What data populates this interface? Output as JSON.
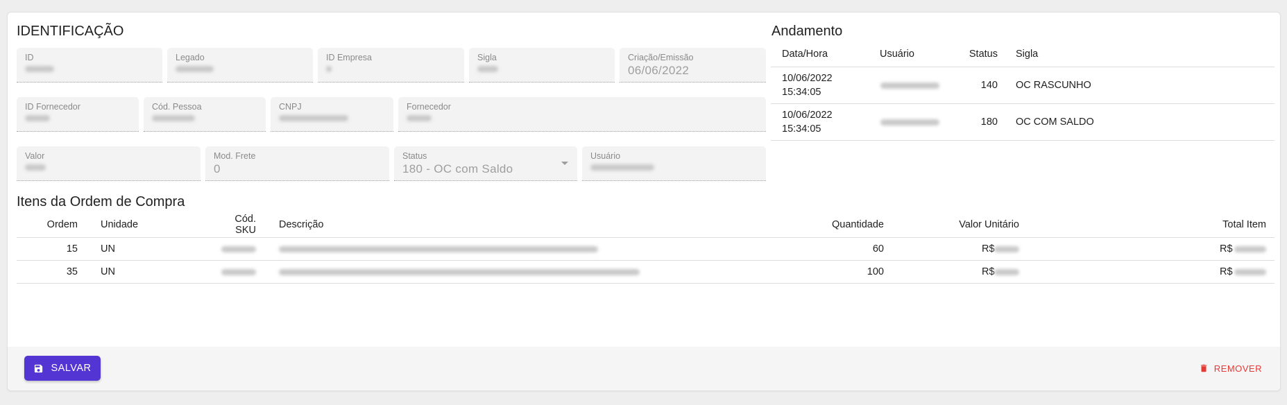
{
  "identificacao": {
    "title": "IDENTIFICAÇÃO",
    "fields": {
      "id": {
        "label": "ID",
        "value": ""
      },
      "legado": {
        "label": "Legado",
        "value": ""
      },
      "id_empresa": {
        "label": "ID Empresa",
        "value": ""
      },
      "sigla": {
        "label": "Sigla",
        "value": ""
      },
      "criacao": {
        "label": "Criação/Emissão",
        "value": "06/06/2022"
      },
      "id_fornecedor": {
        "label": "ID Fornecedor",
        "value": ""
      },
      "cod_pessoa": {
        "label": "Cód. Pessoa",
        "value": ""
      },
      "cnpj": {
        "label": "CNPJ",
        "value": ""
      },
      "fornecedor": {
        "label": "Fornecedor",
        "value": ""
      },
      "valor": {
        "label": "Valor",
        "value": ""
      },
      "mod_frete": {
        "label": "Mod. Frete",
        "value": "0"
      },
      "status": {
        "label": "Status",
        "value": "180 - OC com Saldo"
      },
      "usuario": {
        "label": "Usuário",
        "value": ""
      }
    }
  },
  "andamento": {
    "title": "Andamento",
    "headers": {
      "data_hora": "Data/Hora",
      "usuario": "Usuário",
      "status": "Status",
      "sigla": "Sigla"
    },
    "rows": [
      {
        "date": "10/06/2022",
        "time": "15:34:05",
        "status": "140",
        "sigla": "OC RASCUNHO"
      },
      {
        "date": "10/06/2022",
        "time": "15:34:05",
        "status": "180",
        "sigla": "OC COM SALDO"
      }
    ]
  },
  "itens": {
    "title": "Itens da Ordem de Compra",
    "headers": {
      "ordem": "Ordem",
      "unidade": "Unidade",
      "sku": "Cód. SKU",
      "descricao": "Descrição",
      "quantidade": "Quantidade",
      "valor_unitario": "Valor Unitário",
      "total_item": "Total Item"
    },
    "rows": [
      {
        "ordem": "15",
        "unidade": "UN",
        "quantidade": "60",
        "valor_prefix": "R$",
        "total_prefix": "R$"
      },
      {
        "ordem": "35",
        "unidade": "UN",
        "quantidade": "100",
        "valor_prefix": "R$",
        "total_prefix": "R$"
      }
    ]
  },
  "footer": {
    "save_label": "SALVAR",
    "remove_label": "REMOVER"
  },
  "colors": {
    "primary": "#5335d3",
    "danger": "#e53935"
  }
}
